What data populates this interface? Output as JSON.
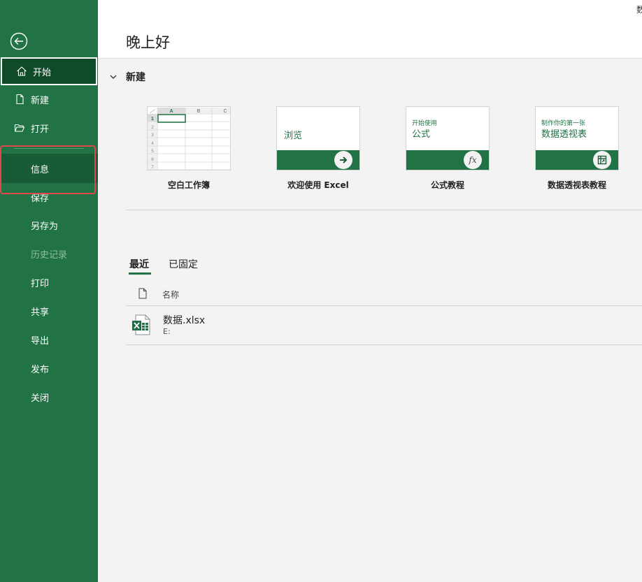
{
  "sidebar": {
    "items": [
      {
        "label": "开始"
      },
      {
        "label": "新建"
      },
      {
        "label": "打开"
      },
      {
        "label": "信息"
      },
      {
        "label": "保存"
      },
      {
        "label": "另存为"
      },
      {
        "label": "历史记录"
      },
      {
        "label": "打印"
      },
      {
        "label": "共享"
      },
      {
        "label": "导出"
      },
      {
        "label": "发布"
      },
      {
        "label": "关闭"
      }
    ]
  },
  "header": {
    "greeting": "晚上好",
    "corner_text": "数"
  },
  "new_section": {
    "title": "新建",
    "templates": [
      {
        "caption": "空白工作簿",
        "grid_cols": [
          "A",
          "B",
          "C"
        ],
        "grid_rows": [
          "1",
          "2",
          "3",
          "4",
          "5",
          "6",
          "7"
        ]
      },
      {
        "caption": "欢迎使用 Excel",
        "thumb_text": "浏览"
      },
      {
        "caption": "公式教程",
        "thumb_small": "开始使用",
        "thumb_big": "公式",
        "icon_text": "fx"
      },
      {
        "caption": "数据透视表教程",
        "thumb_small": "制作你的第一张",
        "thumb_big": "数据透视表"
      }
    ]
  },
  "recent": {
    "tabs": [
      {
        "label": "最近",
        "active": true
      },
      {
        "label": "已固定",
        "active": false
      }
    ],
    "column_name": "名称",
    "files": [
      {
        "name": "数据.xlsx",
        "path": "E:"
      }
    ]
  },
  "colors": {
    "sidebar": "#217346",
    "sidebar_selected": "#185c37",
    "home_selected": "#0f4a29",
    "highlight": "#e0474c",
    "accent": "#217346"
  },
  "icons": {
    "back": "back-arrow-icon",
    "home": "home-icon",
    "new": "new-document-icon",
    "open": "folder-open-icon"
  }
}
